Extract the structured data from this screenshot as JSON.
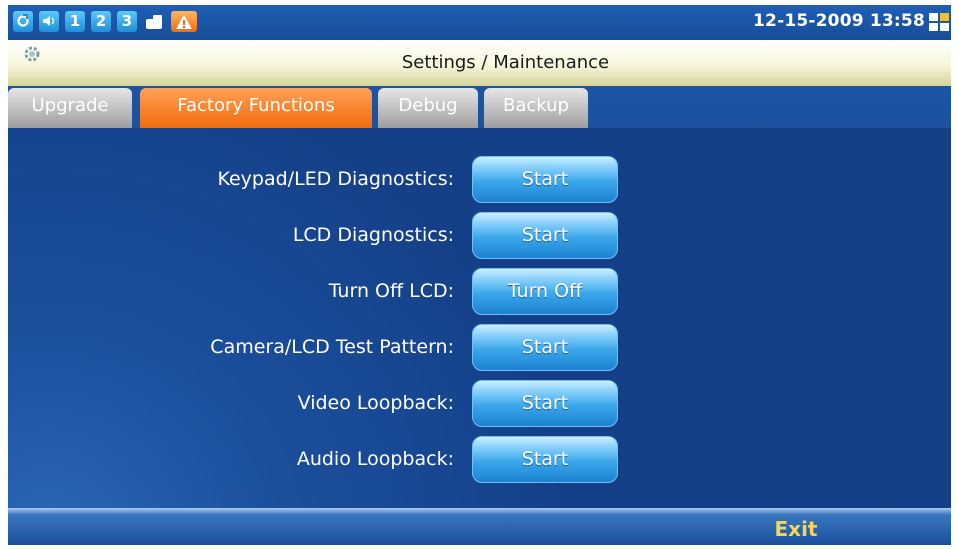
{
  "status_bar": {
    "icons": [
      "refresh-icon",
      "speaker-icon",
      "account-1-icon",
      "account-2-icon",
      "account-3-icon",
      "camera-icon",
      "alert-icon"
    ],
    "account_numbers": [
      "1",
      "2",
      "3"
    ],
    "datetime": "12-15-2009 13:58"
  },
  "title_bar": {
    "title": "Settings / Maintenance"
  },
  "tabs": [
    {
      "label": "Upgrade",
      "active": false
    },
    {
      "label": "Factory Functions",
      "active": true
    },
    {
      "label": "Debug",
      "active": false
    },
    {
      "label": "Backup",
      "active": false
    }
  ],
  "rows": [
    {
      "label": "Keypad/LED Diagnostics:",
      "button": "Start"
    },
    {
      "label": "LCD Diagnostics:",
      "button": "Start"
    },
    {
      "label": "Turn Off LCD:",
      "button": "Turn Off"
    },
    {
      "label": "Camera/LCD Test Pattern:",
      "button": "Start"
    },
    {
      "label": "Video Loopback:",
      "button": "Start"
    },
    {
      "label": "Audio Loopback:",
      "button": "Start"
    }
  ],
  "bottom_bar": {
    "exit_label": "Exit"
  },
  "colors": {
    "accent_tab": "#f06c0e",
    "button": "#3aa6ea",
    "exit": "#f3d75a"
  }
}
